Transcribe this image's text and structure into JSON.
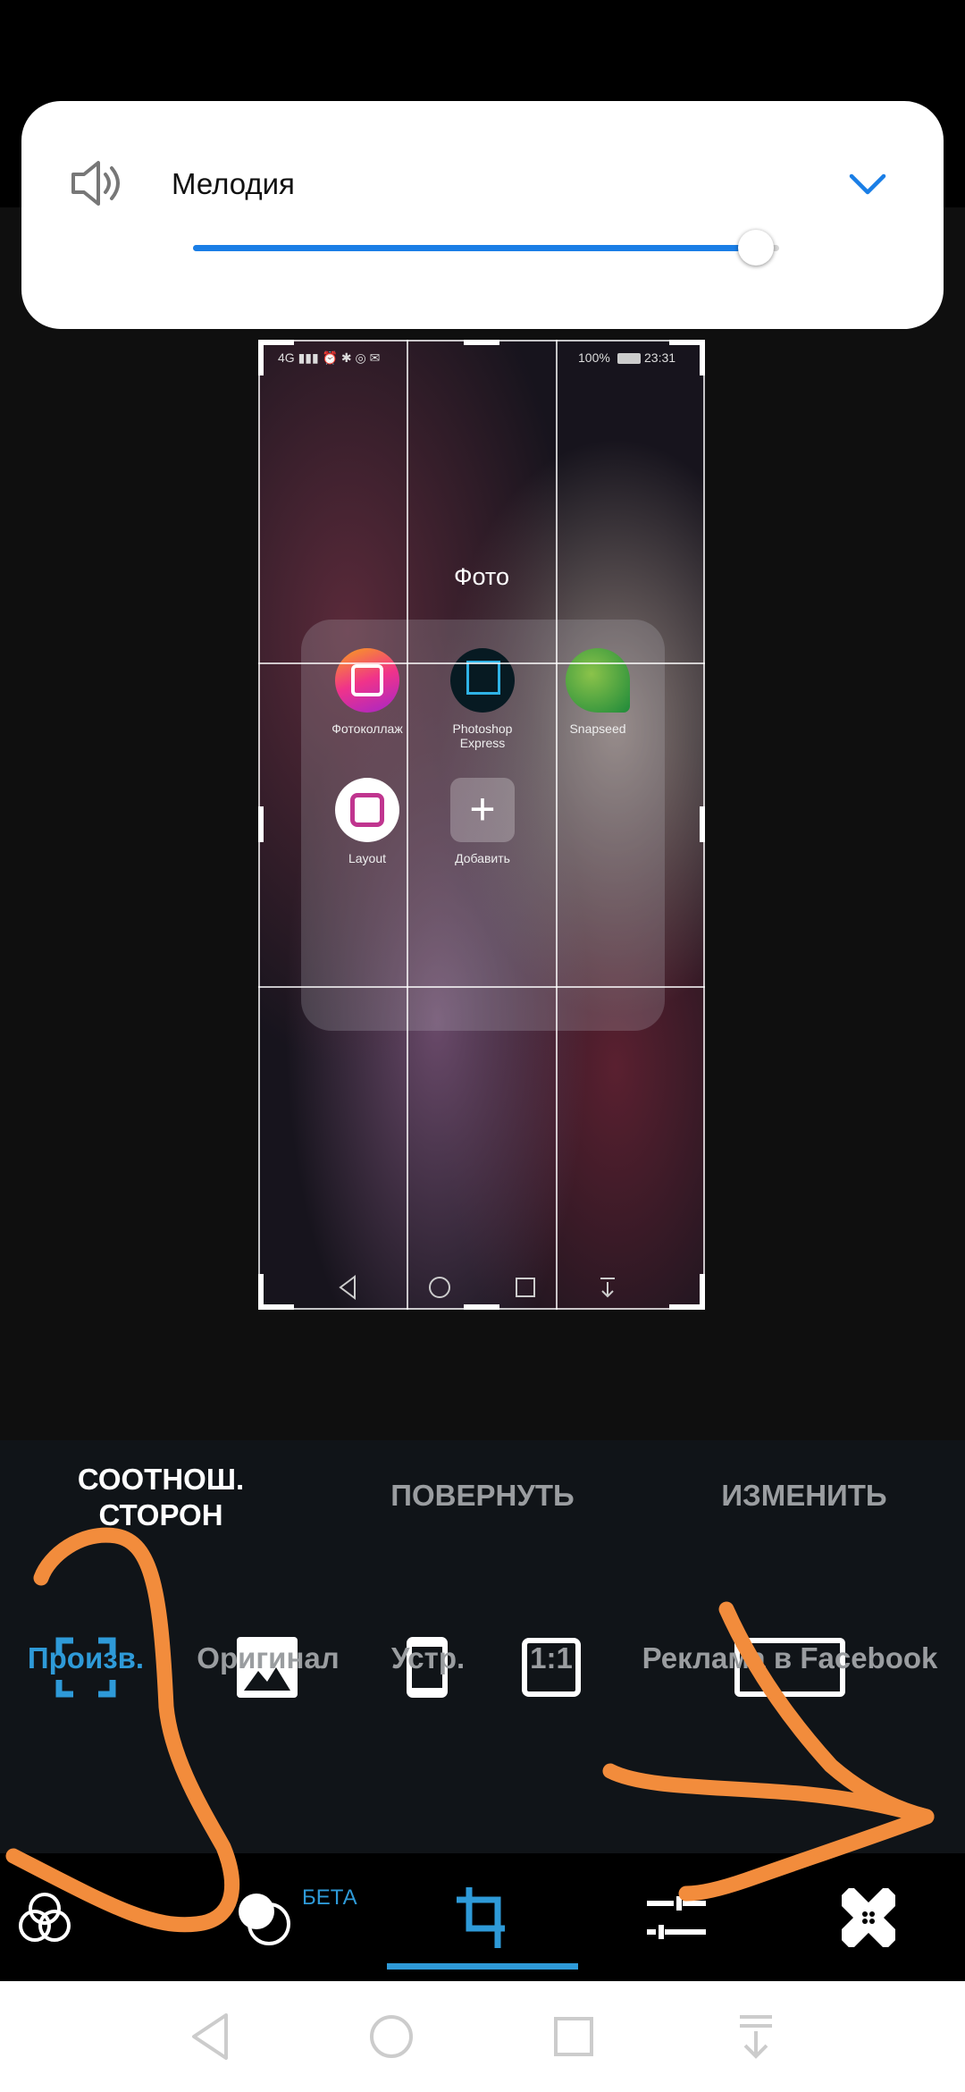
{
  "volume_panel": {
    "title": "Мелодия",
    "level_percent": 96,
    "accent": "#1a7ee6",
    "icon": "speaker-icon",
    "expand_icon": "chevron-down-icon"
  },
  "preview": {
    "status_left": "4G ▮▮▮ ⏰ ✱ ◎ ✉",
    "battery": "100%",
    "time": "23:31",
    "folder_name": "Фото",
    "apps": [
      {
        "label": "Фотоколлаж"
      },
      {
        "label": "Photoshop\nExpress"
      },
      {
        "label": "Snapseed"
      },
      {
        "label": "Layout"
      },
      {
        "label": "Добавить"
      }
    ]
  },
  "tabs": [
    {
      "label": "СООТНОШ. СТОРОН",
      "active": true
    },
    {
      "label": "ПОВЕРНУТЬ"
    },
    {
      "label": "ИЗМЕНИТЬ"
    }
  ],
  "aspect_options": [
    {
      "label": "Произв.",
      "active": true
    },
    {
      "label": "Оригинал"
    },
    {
      "label": "Устр."
    },
    {
      "label": "1:1"
    },
    {
      "label": "Реклама в Facebook"
    }
  ],
  "toolbar": {
    "beta_label": "БЕТА",
    "items": [
      "filters-icon",
      "blend-icon",
      "crop-icon",
      "adjust-icon",
      "heal-icon"
    ],
    "active": "crop-icon",
    "accent": "#2e9ad8"
  },
  "nav": [
    "back-icon",
    "home-icon",
    "recents-icon",
    "notifications-icon"
  ],
  "annotation_color": "#f28c3c"
}
